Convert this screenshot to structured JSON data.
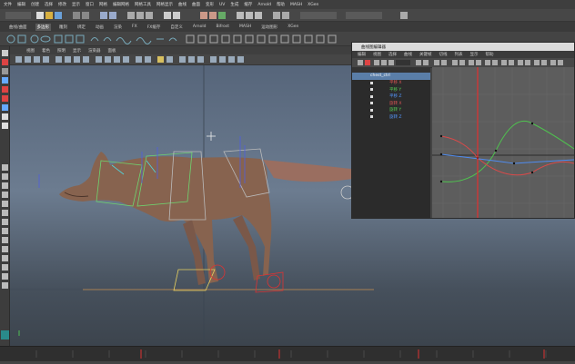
{
  "menubar": {
    "items": [
      "文件",
      "编辑",
      "创建",
      "选择",
      "修改",
      "显示",
      "窗口",
      "网格",
      "编辑网格",
      "网格工具",
      "网格显示",
      "曲线",
      "曲面",
      "变形",
      "UV",
      "生成",
      "缓存",
      "Arnold",
      "帮助",
      "MASH",
      "XGen"
    ]
  },
  "shelf_tabs": {
    "items": [
      "曲线/曲面",
      "多边形",
      "雕刻",
      "绑定",
      "动画",
      "渲染",
      "FX",
      "FX缓存",
      "自定义",
      "Arnold",
      "Bifrost",
      "MASH",
      "运动图形",
      "XGen"
    ],
    "active_index": 1
  },
  "panel_menu": {
    "items": [
      "视图",
      "着色",
      "照明",
      "显示",
      "渲染器",
      "面板"
    ]
  },
  "graph_editor": {
    "title": "曲线图编辑器",
    "menu": [
      "编辑",
      "视图",
      "选择",
      "曲线",
      "关键帧",
      "切线",
      "列表",
      "显示",
      "帮助"
    ],
    "outliner": {
      "selected": "chest_ctrl",
      "channels": [
        {
          "label": "平移 X",
          "color": "#e05555"
        },
        {
          "label": "平移 Y",
          "color": "#55d055"
        },
        {
          "label": "平移 Z",
          "color": "#5599ff"
        },
        {
          "label": "旋转 X",
          "color": "#e05555"
        },
        {
          "label": "旋转 Y",
          "color": "#55d055"
        },
        {
          "label": "旋转 Z",
          "color": "#5599ff"
        }
      ]
    }
  },
  "colors": {
    "viewport_top": "#56657a",
    "wolf_body": "#8a6650",
    "current_frame": "#e03030"
  }
}
